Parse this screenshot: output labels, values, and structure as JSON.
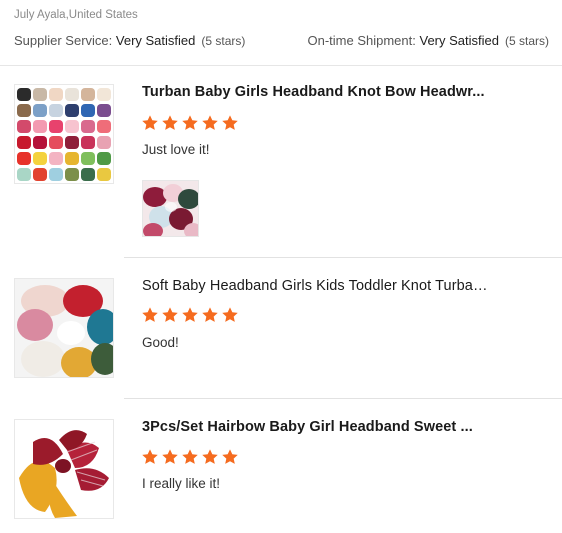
{
  "review_header": {
    "reviewer": "July Ayala,United States",
    "supplier_service": {
      "label": "Supplier Service: ",
      "value": "Very Satisfied",
      "note": "(5 stars)"
    },
    "shipment": {
      "label": "On-time Shipment: ",
      "value": "Very Satisfied",
      "note": "(5 stars)"
    }
  },
  "colors": {
    "star": "#f56b1f",
    "divider": "#e2e2e2",
    "text_muted": "#8a8a8a"
  },
  "products": [
    {
      "title": "Turban Baby Girls Headband Knot Bow Headwr...",
      "rating": 5,
      "comment": "Just love it!",
      "thumbnail_icon": "headband-color-grid-image",
      "has_photo": true
    },
    {
      "title": "Soft Baby Headband Girls Kids Toddler Knot Turban Bi...",
      "rating": 5,
      "comment": "Good!",
      "thumbnail_icon": "headband-bows-image",
      "has_photo": false
    },
    {
      "title": "3Pcs/Set Hairbow Baby Girl Headband Sweet ...",
      "rating": 5,
      "comment": "I really like it!",
      "thumbnail_icon": "hairbow-set-image",
      "has_photo": false
    }
  ]
}
